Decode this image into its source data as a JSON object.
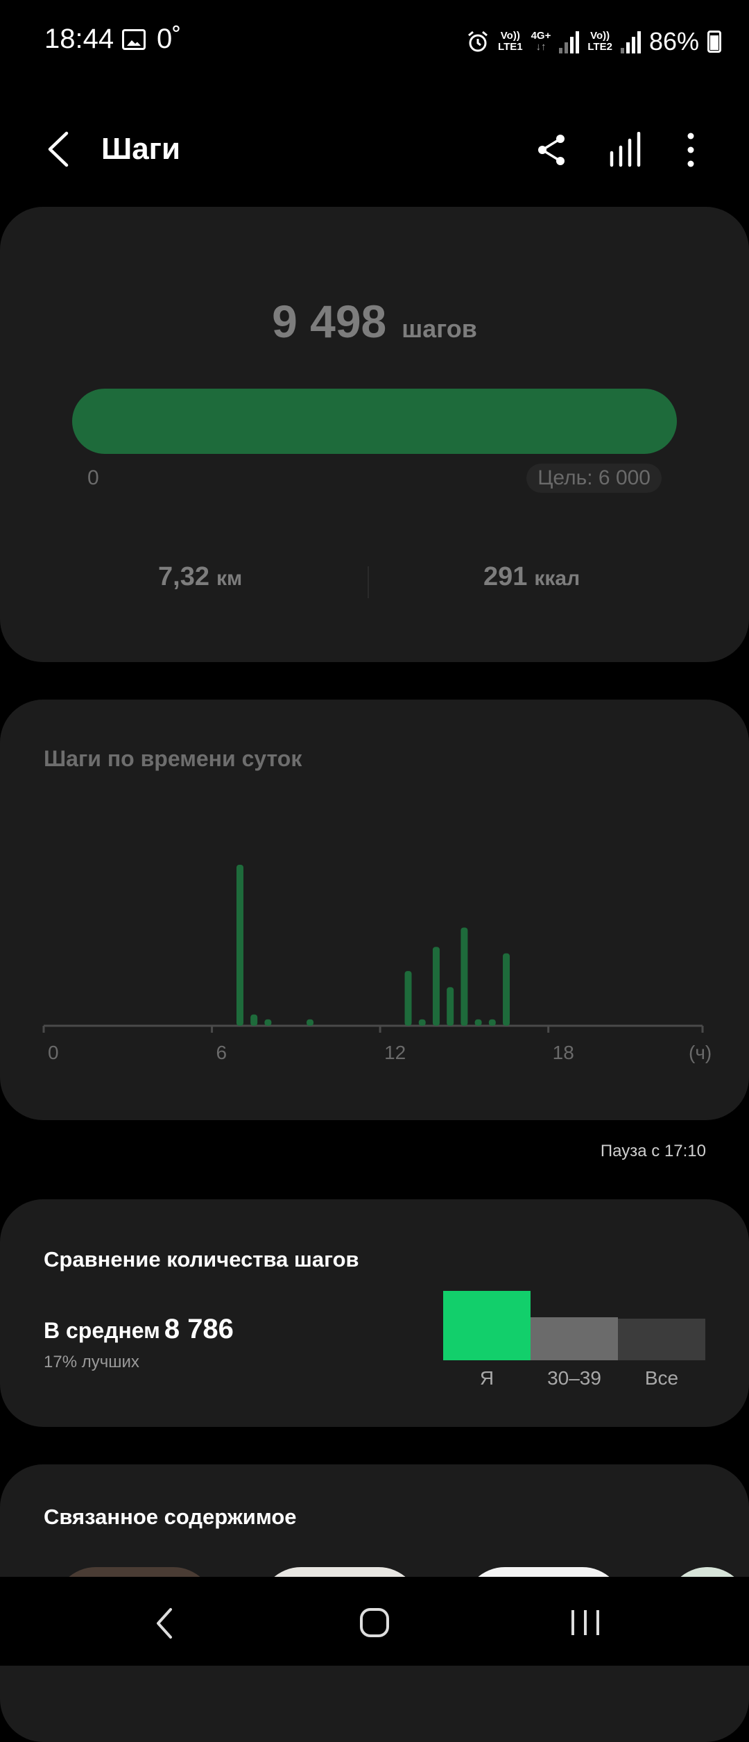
{
  "status_bar": {
    "time": "18:44",
    "temperature": "0˚",
    "sim1_top": "Vo))",
    "sim1_bottom": "LTE1",
    "net_type": "4G+",
    "net_arrows": "↓↑",
    "sim2_top": "Vo))",
    "sim2_bottom": "LTE2",
    "battery": "86%"
  },
  "app_bar": {
    "title": "Шаги",
    "icons": [
      "back-icon",
      "share-icon",
      "chart-icon",
      "more-icon"
    ]
  },
  "summary": {
    "steps_value": "9 498",
    "steps_unit": "шагов",
    "progress_fraction": 1.0,
    "progress_start": "0",
    "goal_label": "Цель: 6 000",
    "distance_value": "7,32",
    "distance_unit": "км",
    "calories_value": "291",
    "calories_unit": "ккал"
  },
  "time_chart": {
    "title": "Шаги по времени суток",
    "chart_data": {
      "type": "bar",
      "xlabel": "(ч)",
      "x_ticks": [
        "0",
        "6",
        "12",
        "18",
        "(ч)"
      ],
      "xlim": [
        0,
        23.5
      ],
      "hours": [
        7.0,
        7.5,
        8.0,
        9.5,
        13.0,
        13.5,
        14.0,
        14.5,
        15.0,
        15.5,
        16.0,
        16.5
      ],
      "relative_values": [
        1.0,
        0.07,
        0.04,
        0.04,
        0.34,
        0.04,
        0.49,
        0.24,
        0.61,
        0.04,
        0.04,
        0.45
      ],
      "color": "#1e6b3b"
    }
  },
  "pause_text": "Пауза с 17:10",
  "comparison": {
    "title": "Сравнение количества шагов",
    "average_label": "В среднем",
    "average_value": "8 786",
    "better_text": "17% лучших",
    "chart_data": {
      "type": "bar",
      "categories": [
        "Я",
        "30–39",
        "Все"
      ],
      "relative_values": [
        1.0,
        0.62,
        0.6
      ],
      "colors": [
        "#12cf6b",
        "#6b6b6b",
        "#3c3c3c"
      ]
    }
  },
  "related": {
    "title": "Связанное содержимое"
  },
  "nav_bar": {
    "icons": [
      "nav-back-icon",
      "nav-home-icon",
      "nav-recents-icon"
    ]
  }
}
